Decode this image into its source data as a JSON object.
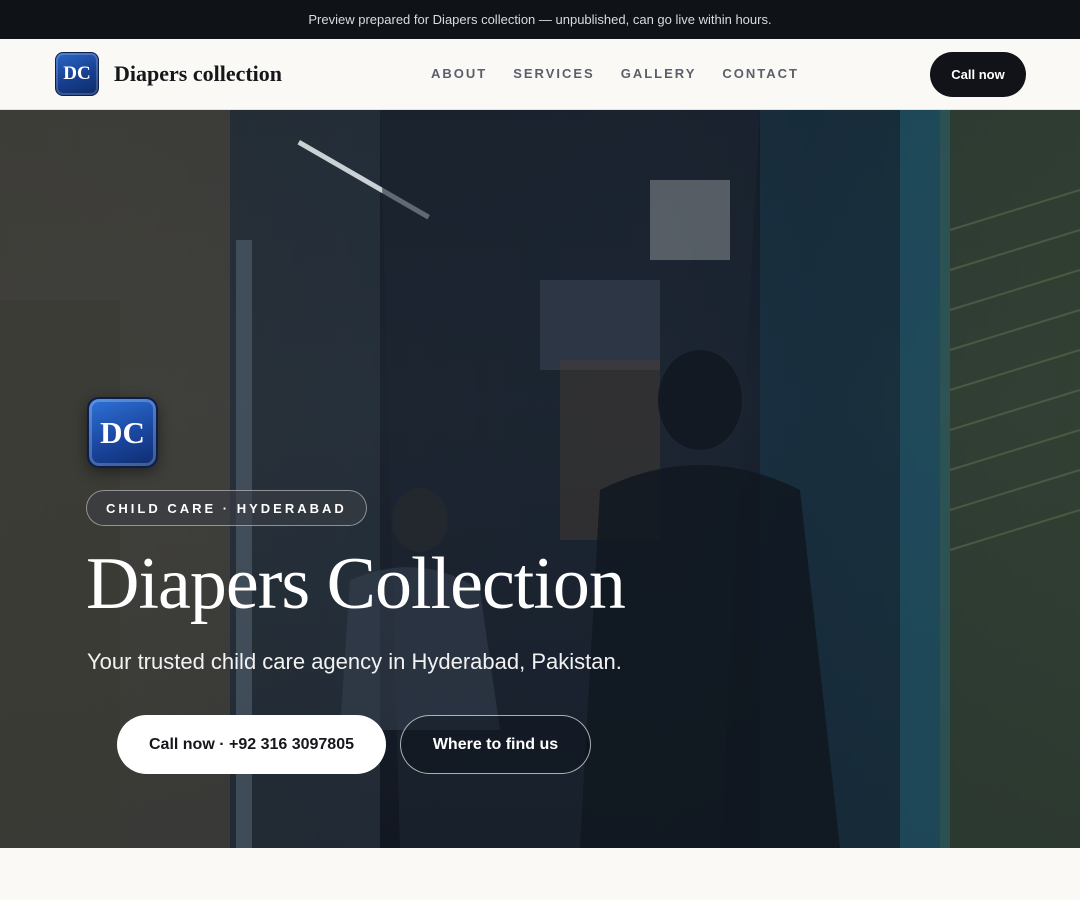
{
  "preview_bar": {
    "text": "Preview prepared for Diapers collection — unpublished, can go live within hours."
  },
  "nav": {
    "logo_initials": "DC",
    "brand_name": "Diapers collection",
    "links": [
      {
        "label": "ABOUT"
      },
      {
        "label": "SERVICES"
      },
      {
        "label": "GALLERY"
      },
      {
        "label": "CONTACT"
      }
    ],
    "cta_label": "Call now"
  },
  "hero": {
    "logo_initials": "DC",
    "tag": "CHILD CARE · HYDERABAD",
    "title": "Diapers Collection",
    "subtitle": "Your trusted child care agency in Hyderabad, Pakistan.",
    "primary_button": "Call now · +92 316 3097805",
    "secondary_button": "Where to find us"
  },
  "colors": {
    "preview_bar_bg": "#0f1217",
    "nav_bg": "#faf9f6",
    "cta_dark": "#111318",
    "logo_blue": "#1a47a0"
  }
}
